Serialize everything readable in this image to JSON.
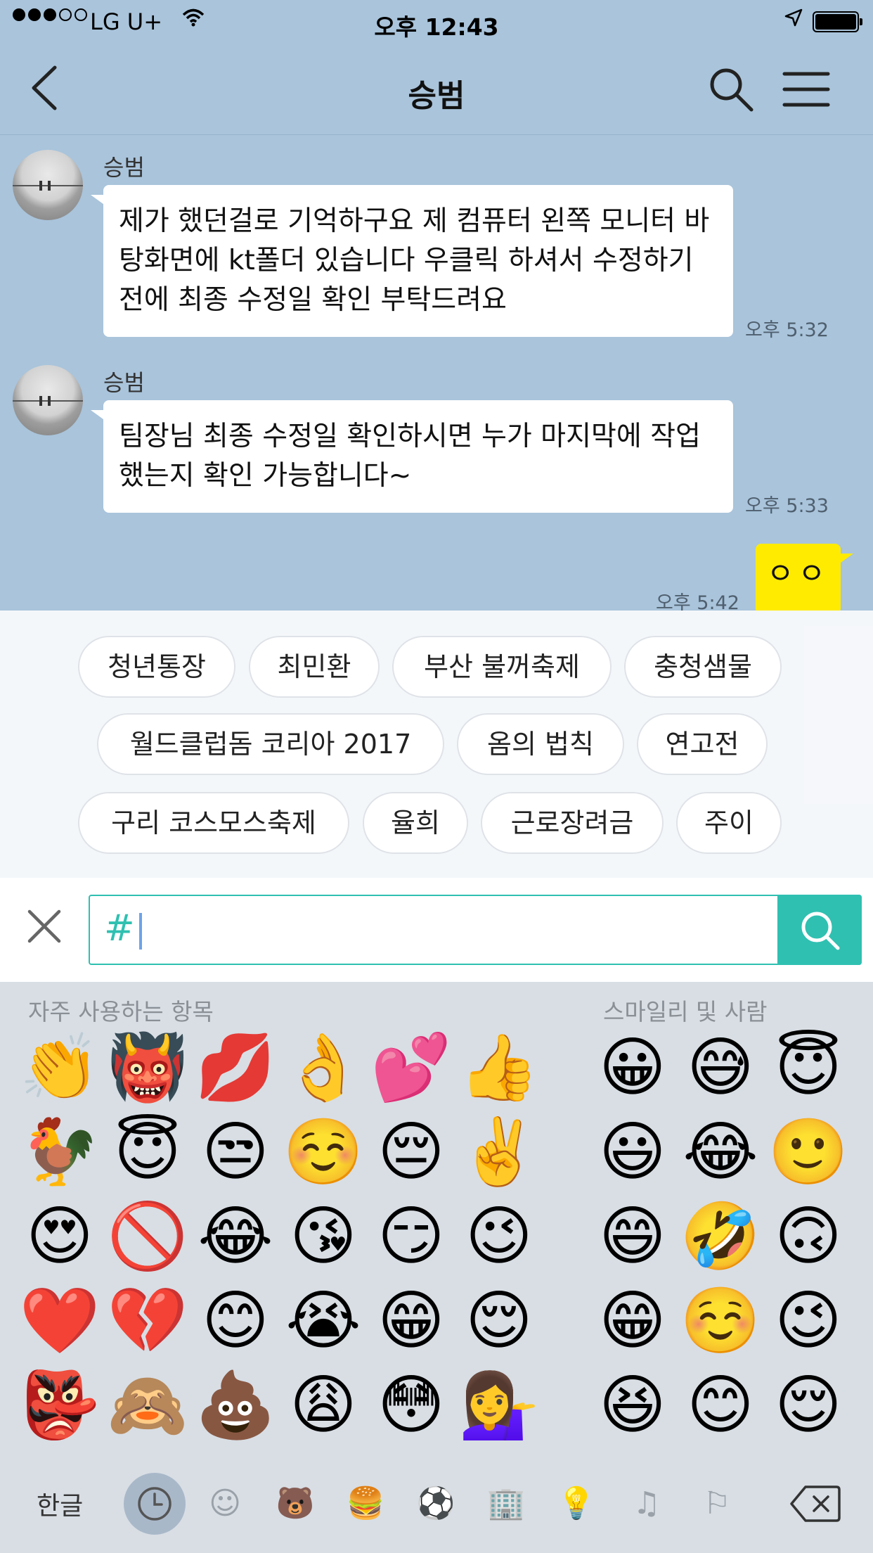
{
  "status_bar": {
    "carrier": "LG U+",
    "time": "오후 12:43"
  },
  "header": {
    "title": "승범"
  },
  "messages": [
    {
      "sender": "승범",
      "text": "제가 했던걸로 기억하구요 제 컴퓨터 왼쪽 모니터 바탕화면에 kt폴더 있습니다 우클릭 하셔서 수정하기전에 최종 수정일 확인 부탁드려요",
      "time": "오후 5:32"
    },
    {
      "sender": "승범",
      "text": "팀장님 최종 수정일 확인하시면 누가 마지막에 작업했는지 확인 가능합니다~",
      "time": "오후 5:33"
    },
    {
      "sender": "me",
      "text": "ㅇㅇ",
      "time": "오후 5:42"
    }
  ],
  "trending_tags": [
    "청년통장",
    "최민환",
    "부산 불꺼축제",
    "충청샘물",
    "월드클럽돔 코리아 2017",
    "옴의 법칙",
    "연고전",
    "구리 코스모스축제",
    "율희",
    "근로장려금",
    "주이"
  ],
  "search": {
    "prefix": "#",
    "value": ""
  },
  "keyboard": {
    "frequent_label": "자주 사용하는 항목",
    "smileys_label": "스마일리 및 사람",
    "frequent": [
      "👏",
      "👹",
      "💋",
      "👌",
      "💕",
      "👍",
      "🐓",
      "😇",
      "😒",
      "☺️",
      "😔",
      "✌️",
      "😍",
      "🚫",
      "😂",
      "😘",
      "😏",
      "😉",
      "❤️",
      "💔",
      "😊",
      "😭",
      "😁",
      "😌",
      "👺",
      "🙈",
      "💩",
      "😩",
      "😳",
      "💁‍♀️"
    ],
    "smileys": [
      "😀",
      "😅",
      "😇",
      "😃",
      "😂",
      "🙂",
      "😄",
      "🤣",
      "🙃",
      "😁",
      "☺️",
      "😉",
      "😆",
      "😊",
      "😌"
    ],
    "hangul_label": "한글"
  }
}
